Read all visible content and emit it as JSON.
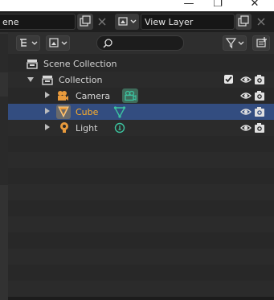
{
  "window": {
    "minimize_glyph": "—",
    "restore_glyph": "❐",
    "close_glyph": "✕"
  },
  "top_header": {
    "scene_text": "ene",
    "view_layer_text": "View Layer"
  },
  "outliner": {
    "search_placeholder": "",
    "tree": [
      {
        "label": "Scene Collection",
        "icon": "scene-collection-icon"
      },
      {
        "label": "Collection",
        "icon": "collection-icon",
        "checked": true
      },
      {
        "label": "Camera",
        "icon": "camera-object-icon",
        "data_icon": "camera-data-icon"
      },
      {
        "label": "Cube",
        "icon": "mesh-object-icon",
        "data_icon": "mesh-data-icon",
        "selected": true
      },
      {
        "label": "Light",
        "icon": "light-object-icon",
        "data_icon": "light-data-icon"
      }
    ]
  },
  "colors": {
    "background": "#282828",
    "selected_row": "#334d80",
    "active_text": "#ffaf29",
    "data_icon_teal": "#3cc3a0",
    "object_orange": "#e89a3c"
  }
}
